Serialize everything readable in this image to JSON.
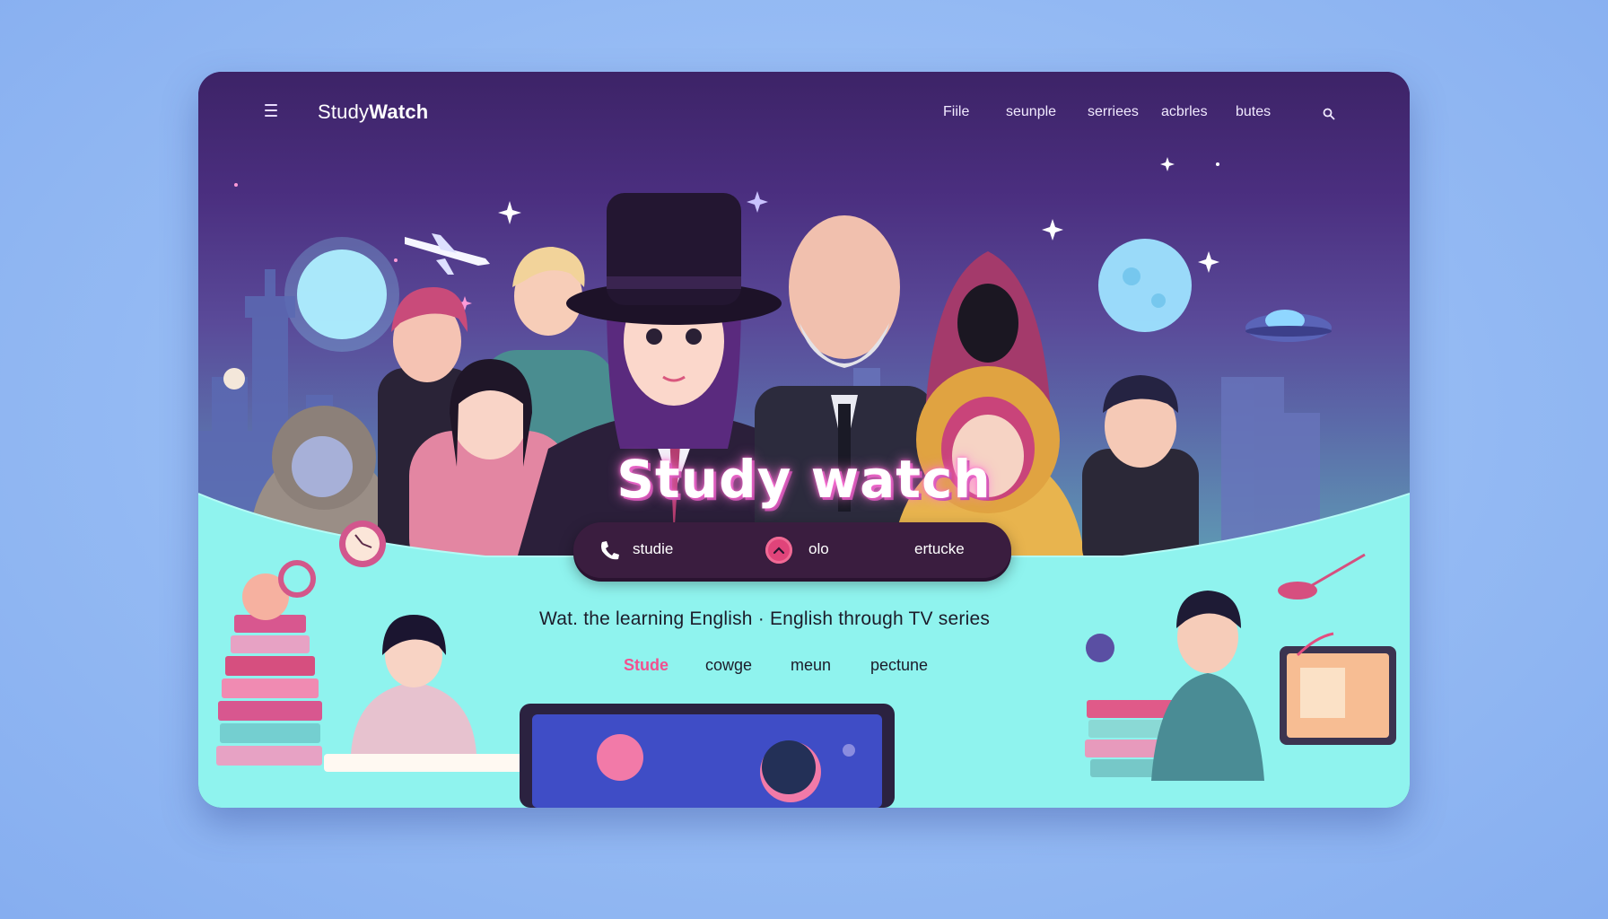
{
  "app": {
    "logo_light": "Study",
    "logo_bold": "Watch"
  },
  "nav": {
    "items": [
      "Fiile",
      "seunple",
      "serriees",
      "acbrles",
      "butes"
    ]
  },
  "hero": {
    "title": "Study watch",
    "pill": {
      "left_label": "studie",
      "center_label": "olo",
      "right_label": "ertucke"
    }
  },
  "tagline": "Wat. the learning English · English through TV series",
  "links": {
    "items": [
      "Stude",
      "cowge",
      "meun",
      "pectune"
    ]
  },
  "colors": {
    "page_bg": "#97bdf6",
    "sky_top": "#3d2367",
    "ground": "#8ff3ee",
    "accent_pink": "#f2508f",
    "pill_bg": "#3a1d3f"
  },
  "icons": [
    "menu-icon",
    "search-icon",
    "phone-icon",
    "chevron-up-icon"
  ]
}
